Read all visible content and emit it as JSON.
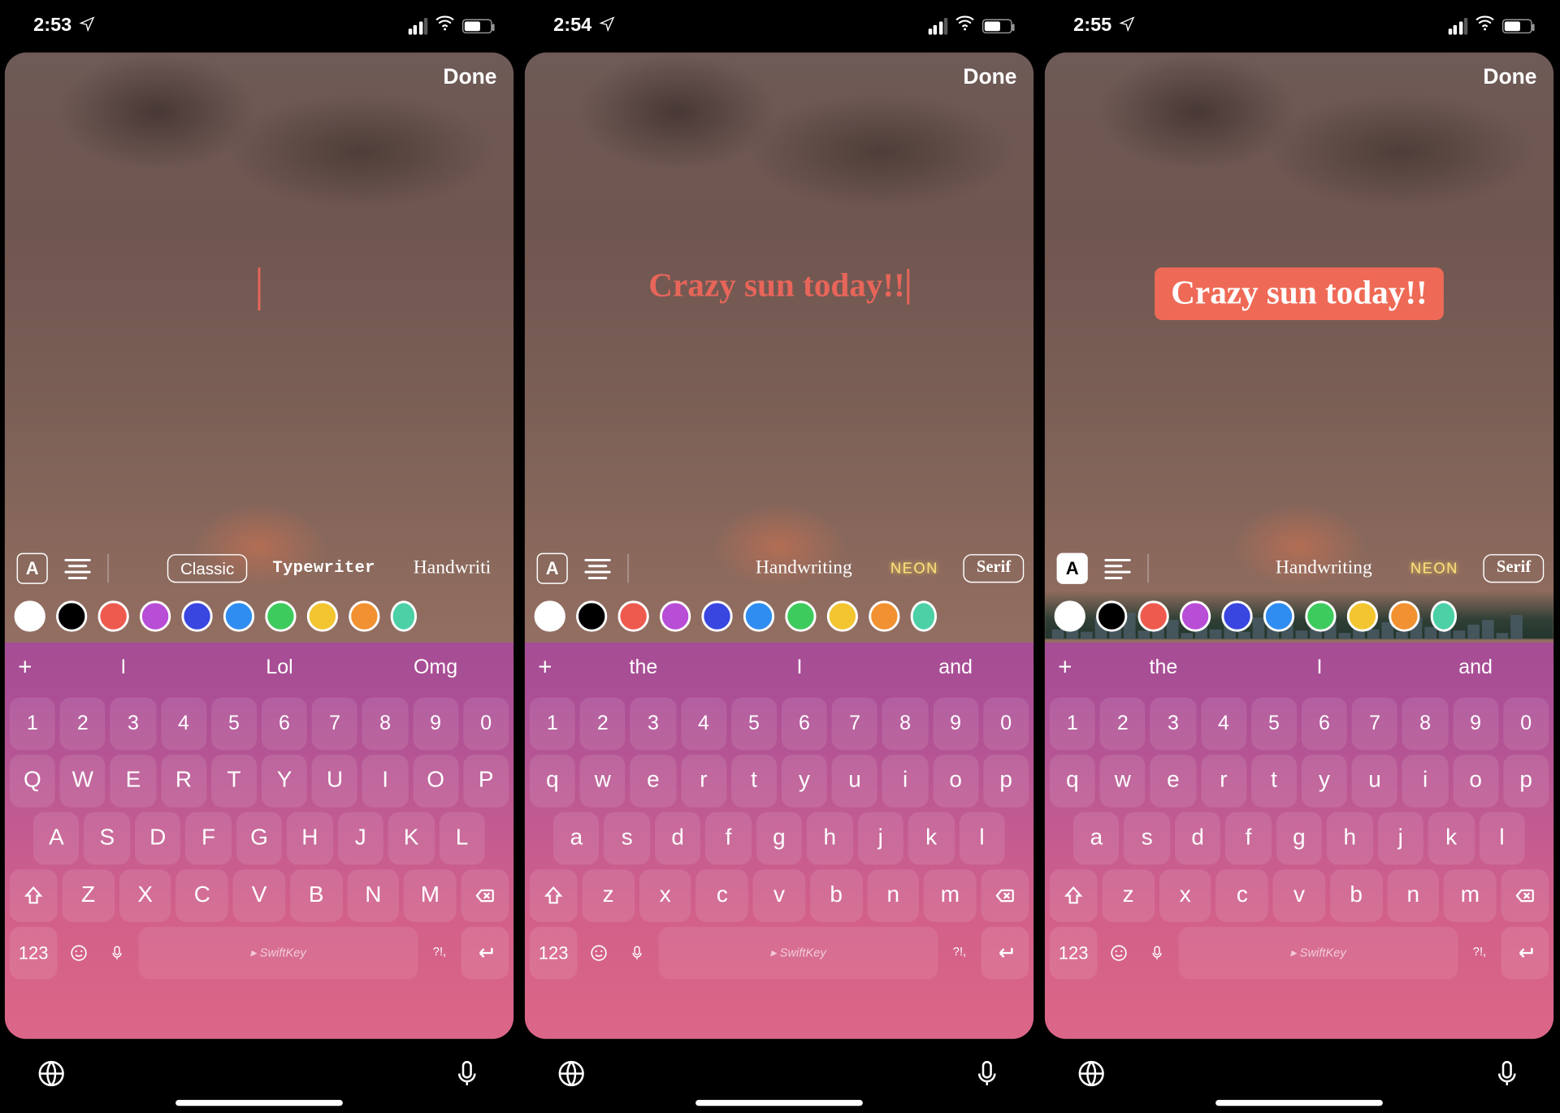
{
  "shots": [
    {
      "time": "2:53",
      "done": "Done",
      "text_mode": "caret",
      "text": "",
      "align": "center",
      "a_filled": false,
      "fonts_visible": [
        "Classic",
        "Typewriter",
        "Handwriti"
      ],
      "font_selected": "Classic",
      "swatches": [
        "#ffffff",
        "#000000",
        "#ef5a4f",
        "#b84dd6",
        "#3a46e0",
        "#2f8df2",
        "#3ecb5d",
        "#f3c531",
        "#f19131",
        "#4cd0a6"
      ],
      "swatch_selected": 2,
      "sugg": [
        "I",
        "Lol",
        "Omg"
      ],
      "kb_case": "upper",
      "kb_rows": {
        "num": [
          "1",
          "2",
          "3",
          "4",
          "5",
          "6",
          "7",
          "8",
          "9",
          "0"
        ],
        "r1": [
          "Q",
          "W",
          "E",
          "R",
          "T",
          "Y",
          "U",
          "I",
          "O",
          "P"
        ],
        "r2": [
          "A",
          "S",
          "D",
          "F",
          "G",
          "H",
          "J",
          "K",
          "L"
        ],
        "r3": [
          "Z",
          "X",
          "C",
          "V",
          "B",
          "N",
          "M"
        ]
      },
      "kb_low": {
        "num123": "123",
        "swift": "SwiftKey",
        "sym": "?!,"
      }
    },
    {
      "time": "2:54",
      "done": "Done",
      "text_mode": "plain",
      "text": "Crazy sun today!!",
      "align": "center",
      "a_filled": false,
      "fonts_visible": [
        "Handwriting",
        "NEON",
        "Serif"
      ],
      "font_selected": "Serif",
      "swatches": [
        "#ffffff",
        "#000000",
        "#ef5a4f",
        "#b84dd6",
        "#3a46e0",
        "#2f8df2",
        "#3ecb5d",
        "#f3c531",
        "#f19131",
        "#4cd0a6"
      ],
      "swatch_selected": 2,
      "sugg": [
        "the",
        "I",
        "and"
      ],
      "kb_case": "lower",
      "kb_rows": {
        "num": [
          "1",
          "2",
          "3",
          "4",
          "5",
          "6",
          "7",
          "8",
          "9",
          "0"
        ],
        "r1": [
          "q",
          "w",
          "e",
          "r",
          "t",
          "y",
          "u",
          "i",
          "o",
          "p"
        ],
        "r2": [
          "a",
          "s",
          "d",
          "f",
          "g",
          "h",
          "j",
          "k",
          "l"
        ],
        "r3": [
          "z",
          "x",
          "c",
          "v",
          "b",
          "n",
          "m"
        ]
      },
      "kb_low": {
        "num123": "123",
        "swift": "SwiftKey",
        "sym": "?!,"
      }
    },
    {
      "time": "2:55",
      "done": "Done",
      "text_mode": "boxed",
      "text": "Crazy sun today!!",
      "align": "left",
      "a_filled": true,
      "fonts_visible": [
        "Handwriting",
        "NEON",
        "Serif"
      ],
      "font_selected": "Serif",
      "swatches": [
        "#ffffff",
        "#000000",
        "#ef5a4f",
        "#b84dd6",
        "#3a46e0",
        "#2f8df2",
        "#3ecb5d",
        "#f3c531",
        "#f19131",
        "#4cd0a6"
      ],
      "swatch_selected": 2,
      "sugg": [
        "the",
        "I",
        "and"
      ],
      "kb_case": "lower",
      "kb_rows": {
        "num": [
          "1",
          "2",
          "3",
          "4",
          "5",
          "6",
          "7",
          "8",
          "9",
          "0"
        ],
        "r1": [
          "q",
          "w",
          "e",
          "r",
          "t",
          "y",
          "u",
          "i",
          "o",
          "p"
        ],
        "r2": [
          "a",
          "s",
          "d",
          "f",
          "g",
          "h",
          "j",
          "k",
          "l"
        ],
        "r3": [
          "z",
          "x",
          "c",
          "v",
          "b",
          "n",
          "m"
        ]
      },
      "kb_low": {
        "num123": "123",
        "swift": "SwiftKey",
        "sym": "?!,"
      }
    }
  ]
}
